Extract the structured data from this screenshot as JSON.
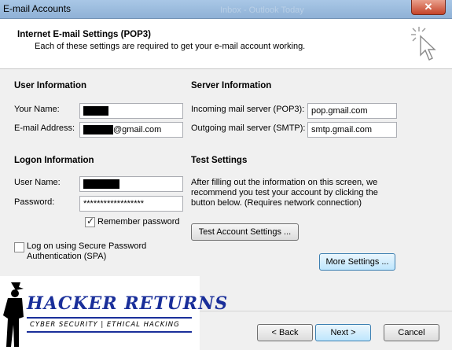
{
  "window": {
    "title": "E-mail Accounts",
    "ghost_title": "Inbox - Outlook Today",
    "close_label": "✕"
  },
  "header": {
    "title": "Internet E-mail Settings (POP3)",
    "subtitle": "Each of these settings are required to get your e-mail account working."
  },
  "user_info": {
    "heading": "User Information",
    "name_label": "Your Name:",
    "email_label": "E-mail Address:",
    "email_suffix": "@gmail.com"
  },
  "server_info": {
    "heading": "Server Information",
    "incoming_label": "Incoming mail server (POP3):",
    "incoming_value": "pop.gmail.com",
    "outgoing_label": "Outgoing mail server (SMTP):",
    "outgoing_value": "smtp.gmail.com"
  },
  "logon_info": {
    "heading": "Logon Information",
    "username_label": "User Name:",
    "password_label": "Password:",
    "password_value": "******************",
    "remember_label": "Remember password",
    "remember_checked": true,
    "spa_label_line1": "Log on using Secure Password",
    "spa_label_line2": "Authentication (SPA)",
    "spa_checked": false
  },
  "test_settings": {
    "heading": "Test Settings",
    "line1": "After filling out the information on this screen, we",
    "line2": "recommend you test your account by clicking the",
    "line3": "button below. (Requires network connection)",
    "test_button": "Test Account Settings ..."
  },
  "buttons": {
    "more_settings": "More Settings ...",
    "back": "< Back",
    "next": "Next >",
    "cancel": "Cancel"
  },
  "watermark": {
    "title": "HACKER RETURNS",
    "subtitle": "CYBER SECURITY | ETHICAL HACKING"
  }
}
